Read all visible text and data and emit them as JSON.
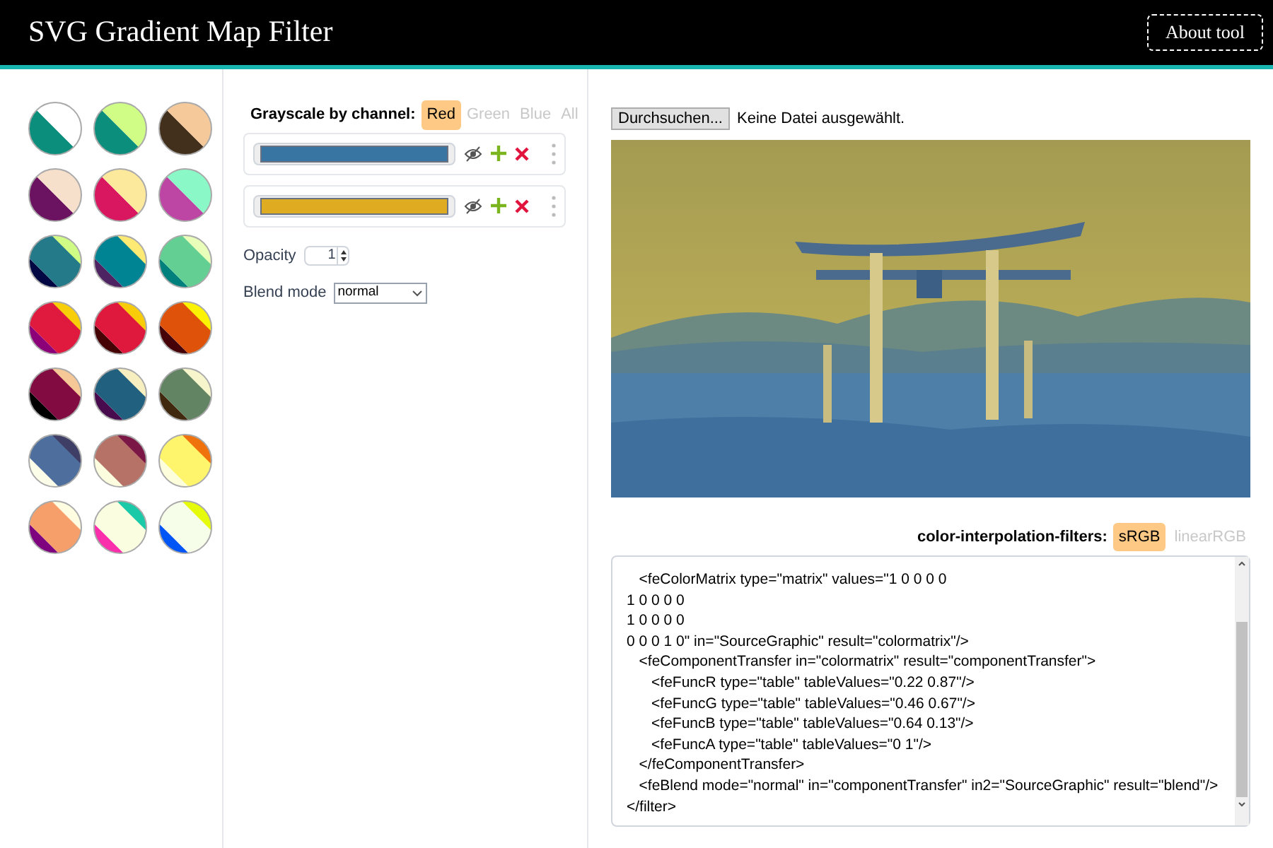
{
  "header": {
    "title": "SVG Gradient Map Filter",
    "about_button": "About tool"
  },
  "channel": {
    "label": "Grayscale by channel:",
    "tabs": [
      {
        "label": "Red",
        "selected": true
      },
      {
        "label": "Green",
        "selected": false
      },
      {
        "label": "Blue",
        "selected": false
      },
      {
        "label": "All",
        "selected": false
      }
    ]
  },
  "stops": [
    {
      "color": "#3875a3"
    },
    {
      "color": "#deab21"
    }
  ],
  "opacity": {
    "label": "Opacity",
    "value": "1"
  },
  "blend_mode": {
    "label": "Blend mode",
    "value": "normal"
  },
  "file_input": {
    "button": "Durchsuchen...",
    "status": "Keine Datei ausgewählt."
  },
  "color_interpolation": {
    "label": "color-interpolation-filters:",
    "tabs": [
      {
        "label": "sRGB",
        "selected": true
      },
      {
        "label": "linearRGB",
        "selected": false
      }
    ]
  },
  "code": {
    "value": "\t<feColorMatrix type=\"matrix\" values=\"1 0 0 0 0\n1 0 0 0 0\n1 0 0 0 0\n0 0 0 1 0\" in=\"SourceGraphic\" result=\"colormatrix\"/>\n\t<feComponentTransfer in=\"colormatrix\" result=\"componentTransfer\">\n\t\t<feFuncR type=\"table\" tableValues=\"0.22 0.87\"/>\n\t\t<feFuncG type=\"table\" tableValues=\"0.46 0.67\"/>\n\t\t<feFuncB type=\"table\" tableValues=\"0.64 0.13\"/>\n\t\t<feFuncA type=\"table\" tableValues=\"0 1\"/>\n\t</feComponentTransfer>\n\t<feBlend mode=\"normal\" in=\"componentTransfer\" in2=\"SourceGraphic\" result=\"blend\"/>\n</filter>"
  }
}
